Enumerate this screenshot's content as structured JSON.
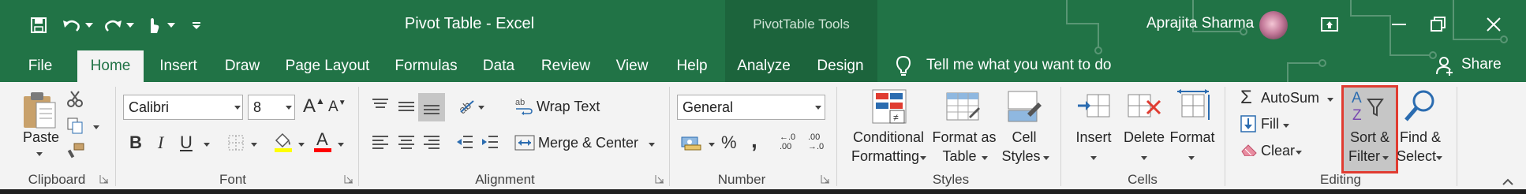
{
  "window": {
    "title": "Pivot Table  -  Excel",
    "context_tools": "PivotTable Tools",
    "user_name": "Aprajita Sharma",
    "share_label": "Share"
  },
  "tabs": [
    "File",
    "Home",
    "Insert",
    "Draw",
    "Page Layout",
    "Formulas",
    "Data",
    "Review",
    "View",
    "Help",
    "Analyze",
    "Design"
  ],
  "tell_me": "Tell me what you want to do",
  "clipboard": {
    "paste": "Paste",
    "group": "Clipboard"
  },
  "font": {
    "name": "Calibri",
    "size": "8",
    "group": "Font"
  },
  "alignment": {
    "wrap_text": "Wrap Text",
    "merge_center": "Merge & Center",
    "group": "Alignment"
  },
  "number": {
    "format": "General",
    "group": "Number",
    "comma": ",",
    "inc_decimal": "←.0\n.00",
    "dec_decimal": ".00\n→.0"
  },
  "styles": {
    "conditional": [
      "Conditional",
      "Formatting"
    ],
    "format_table": [
      "Format as",
      "Table"
    ],
    "cell_styles": [
      "Cell",
      "Styles"
    ],
    "group": "Styles"
  },
  "cells": {
    "insert": "Insert",
    "delete": "Delete",
    "format": "Format",
    "group": "Cells"
  },
  "editing": {
    "autosum": "AutoSum",
    "fill": "Fill",
    "clear": "Clear",
    "sort_filter": [
      "Sort &",
      "Filter"
    ],
    "find_select": [
      "Find &",
      "Select"
    ],
    "group": "Editing"
  },
  "colors": {
    "excel_green": "#217346",
    "context_band": "#1c643c",
    "highlight": "#e03c31",
    "fill_yellow": "#ffff00",
    "font_red": "#ff0000"
  }
}
